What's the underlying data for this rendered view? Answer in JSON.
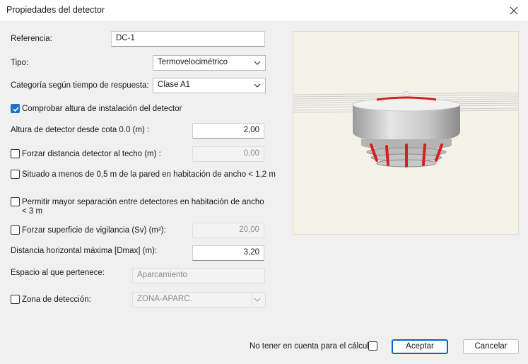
{
  "window": {
    "title": "Propiedades del detector"
  },
  "form": {
    "referencia": {
      "label": "Referencia:",
      "value": "DC-1"
    },
    "tipo": {
      "label": "Tipo:",
      "selected": "Termovelocimétrico"
    },
    "categoria": {
      "label": "Categoría según tiempo de respuesta:",
      "selected": "Clase A1"
    },
    "comprobar_altura": {
      "label": "Comprobar altura de instalación del detector",
      "checked": true
    },
    "altura": {
      "label": "Altura de detector desde cota 0.0 (m) :",
      "value": "2,00"
    },
    "forzar_distancia": {
      "label": "Forzar distancia detector al techo (m) :",
      "checked": false,
      "value": "0,00"
    },
    "situado": {
      "label": "Situado a menos de 0,5 m de la pared en habitación de ancho < 1,2 m",
      "checked": false
    },
    "permitir": {
      "label": "Permitir mayor separación entre detectores en habitación de ancho < 3 m",
      "checked": false
    },
    "forzar_superficie": {
      "label": "Forzar superficie de vigilancia (Sv) (m²):",
      "checked": false,
      "value": "20,00"
    },
    "distancia": {
      "label": "Distancia horizontal máxima [Dmax] (m):",
      "value": "3,20"
    },
    "espacio": {
      "label": "Espacio al que pertenece:",
      "value": "Aparcamiento"
    },
    "zona": {
      "label": "Zona de detección:",
      "checked": false,
      "selected": "ZONA-APARC."
    }
  },
  "footer": {
    "no_tener_label": "No tener en cuenta para el cálculo",
    "no_tener_checked": false,
    "accept_label": "Aceptar",
    "cancel_label": "Cancelar"
  },
  "icons": {
    "close": "close-icon",
    "chevron": "chevron-down-icon",
    "check": "checkmark-icon"
  },
  "colors": {
    "accent": "#1f6fc5",
    "preview_bg": "#f5f3e7",
    "detector_red": "#d81e1e"
  }
}
